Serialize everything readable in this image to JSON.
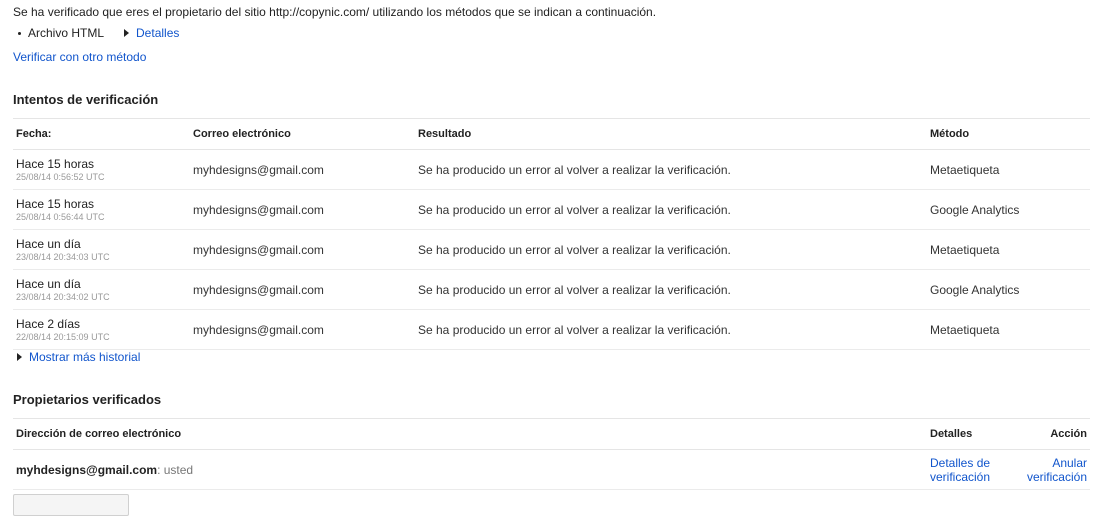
{
  "intro_text": "Se ha verificado que eres el propietario del sitio http://copynic.com/ utilizando los métodos que se indican a continuación.",
  "methods": {
    "name": "Archivo HTML",
    "details_link": "Detalles"
  },
  "verify_other_link": "Verificar con otro método",
  "attempts": {
    "title": "Intentos de verificación",
    "headers": {
      "date": "Fecha:",
      "email": "Correo electrónico",
      "result": "Resultado",
      "method": "Método"
    },
    "rows": [
      {
        "rel": "Hace 15 horas",
        "abs": "25/08/14 0:56:52 UTC",
        "email": "myhdesigns@gmail.com",
        "result": "Se ha producido un error al volver a realizar la verificación.",
        "method": "Metaetiqueta"
      },
      {
        "rel": "Hace 15 horas",
        "abs": "25/08/14 0:56:44 UTC",
        "email": "myhdesigns@gmail.com",
        "result": "Se ha producido un error al volver a realizar la verificación.",
        "method": "Google Analytics"
      },
      {
        "rel": "Hace un día",
        "abs": "23/08/14 20:34:03 UTC",
        "email": "myhdesigns@gmail.com",
        "result": "Se ha producido un error al volver a realizar la verificación.",
        "method": "Metaetiqueta"
      },
      {
        "rel": "Hace un día",
        "abs": "23/08/14 20:34:02 UTC",
        "email": "myhdesigns@gmail.com",
        "result": "Se ha producido un error al volver a realizar la verificación.",
        "method": "Google Analytics"
      },
      {
        "rel": "Hace 2 días",
        "abs": "22/08/14 20:15:09 UTC",
        "email": "myhdesigns@gmail.com",
        "result": "Se ha producido un error al volver a realizar la verificación.",
        "method": "Metaetiqueta"
      }
    ],
    "show_more": "Mostrar más historial"
  },
  "owners": {
    "title": "Propietarios verificados",
    "headers": {
      "email": "Dirección de correo electrónico",
      "details": "Detalles",
      "action": "Acción"
    },
    "rows": [
      {
        "email": "myhdesigns@gmail.com",
        "you": ": usted",
        "details_line1": "Detalles de",
        "details_line2": "verificación",
        "action": "Anular verificación"
      }
    ]
  }
}
